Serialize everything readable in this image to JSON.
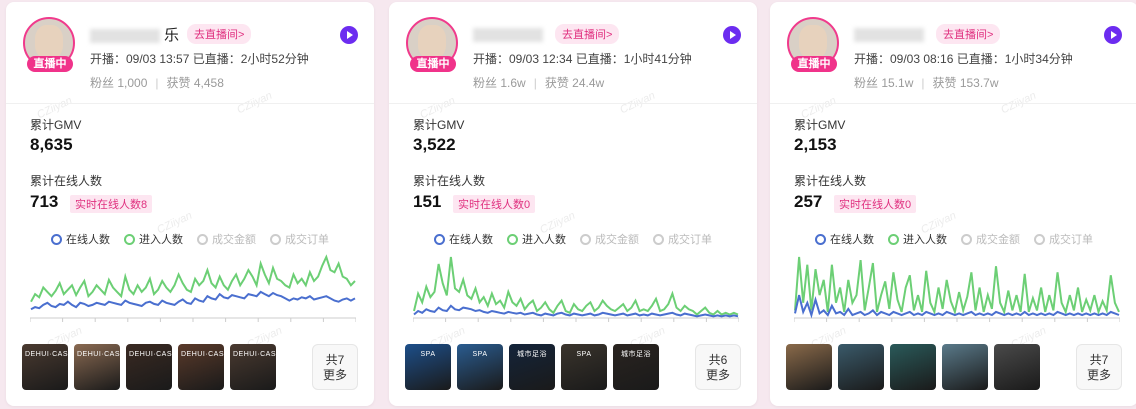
{
  "common": {
    "live_badge": "直播中",
    "goto_live": "去直播间>",
    "gmv_label": "累计GMV",
    "online_label": "累计在线人数",
    "watermark": "CZiiyan",
    "legend": [
      {
        "label": "在线人数",
        "color": "#4a6fcf",
        "active": true
      },
      {
        "label": "进入人数",
        "color": "#6ccf75",
        "active": true
      },
      {
        "label": "成交金额",
        "color": "#cccccc",
        "active": false
      },
      {
        "label": "成交订单",
        "color": "#cccccc",
        "active": false
      }
    ]
  },
  "cards": [
    {
      "name_suffix": "乐",
      "meta": "开播：09/03 13:57 已直播：2小时52分钟",
      "fans": "粉丝 1,000",
      "likes": "获赞 4,458",
      "gmv": "8,635",
      "online": "713",
      "realtime": "实时在线人数8",
      "more_count": "共7",
      "more_label": "更多",
      "thumb_colors": [
        "#4a3a30",
        "#8a6a52",
        "#3a2a22",
        "#5a3a2a",
        "#4a3a30"
      ],
      "thumb_texts": [
        "DEHUI·CASE",
        "DEHUI·CASE",
        "DEHUI·CASE",
        "DEHUI·CASE",
        "DEHUI·CASE"
      ],
      "chart_data": {
        "type": "line",
        "series": [
          {
            "name": "在线人数",
            "values": [
              8,
              10,
              9,
              12,
              14,
              11,
              10,
              13,
              12,
              15,
              12,
              10,
              14,
              13,
              11,
              12,
              14,
              13,
              12,
              15,
              14,
              13,
              12,
              16,
              14,
              13,
              12,
              11,
              14,
              15,
              13,
              12,
              16,
              14,
              13,
              12,
              15,
              17,
              14,
              13,
              18,
              16,
              15,
              20,
              18,
              17,
              22,
              19,
              18,
              21,
              20,
              19,
              18,
              22,
              21,
              20,
              24,
              22,
              20,
              23,
              21,
              20,
              18,
              16,
              18,
              17,
              19,
              18,
              20,
              17,
              18,
              19,
              20,
              18,
              16,
              15,
              17,
              18,
              16,
              18
            ]
          },
          {
            "name": "进入人数",
            "values": [
              15,
              22,
              19,
              28,
              24,
              20,
              25,
              32,
              22,
              26,
              30,
              21,
              28,
              34,
              20,
              24,
              30,
              26,
              22,
              35,
              28,
              24,
              20,
              38,
              26,
              22,
              30,
              24,
              28,
              36,
              22,
              26,
              34,
              28,
              24,
              30,
              40,
              32,
              26,
              24,
              36,
              30,
              34,
              44,
              32,
              28,
              38,
              30,
              26,
              34,
              40,
              30,
              36,
              44,
              38,
              30,
              50,
              40,
              32,
              46,
              36,
              34,
              30,
              28,
              40,
              32,
              36,
              30,
              42,
              34,
              38,
              48,
              56,
              44,
              42,
              50,
              38,
              36,
              30,
              34
            ]
          }
        ]
      }
    },
    {
      "name_suffix": "",
      "meta": "开播：09/03 12:34 已直播：1小时41分钟",
      "fans": "粉丝 1.6w",
      "likes": "获赞 24.4w",
      "gmv": "3,522",
      "online": "151",
      "realtime": "实时在线人数0",
      "more_count": "共6",
      "more_label": "更多",
      "thumb_colors": [
        "#1d4f8a",
        "#2a5c90",
        "#14243a",
        "#3a342c",
        "#2a2420"
      ],
      "thumb_texts": [
        "SPA",
        "SPA",
        "城市足浴",
        "SPA",
        "城市足浴"
      ],
      "chart_data": {
        "type": "line",
        "series": [
          {
            "name": "在线人数",
            "values": [
              4,
              8,
              6,
              10,
              8,
              7,
              12,
              9,
              8,
              14,
              10,
              9,
              12,
              11,
              10,
              8,
              9,
              7,
              6,
              8,
              7,
              6,
              5,
              7,
              6,
              5,
              6,
              4,
              5,
              6,
              4,
              3,
              5,
              4,
              3,
              5,
              6,
              4,
              3,
              5,
              4,
              3,
              4,
              5,
              3,
              4,
              6,
              5,
              4,
              3,
              4,
              5,
              3,
              4,
              5,
              3,
              4,
              3,
              5,
              4,
              3,
              4,
              5,
              6,
              4,
              3,
              5,
              4,
              3,
              2,
              3,
              4,
              3,
              2,
              3,
              2,
              3,
              2,
              3,
              2
            ]
          },
          {
            "name": "进入人数",
            "values": [
              8,
              28,
              18,
              36,
              24,
              30,
              62,
              40,
              26,
              70,
              34,
              30,
              44,
              26,
              22,
              34,
              18,
              24,
              14,
              28,
              16,
              20,
              12,
              30,
              18,
              14,
              22,
              10,
              16,
              20,
              8,
              12,
              18,
              10,
              6,
              14,
              20,
              8,
              6,
              16,
              10,
              8,
              14,
              18,
              8,
              12,
              20,
              14,
              10,
              8,
              12,
              16,
              8,
              12,
              20,
              8,
              10,
              8,
              14,
              22,
              8,
              10,
              16,
              28,
              12,
              8,
              14,
              10,
              8,
              4,
              8,
              12,
              6,
              4,
              8,
              4,
              6,
              4,
              6,
              4
            ]
          }
        ]
      }
    },
    {
      "name_suffix": "",
      "meta": "开播：09/03 08:16 已直播：1小时34分钟",
      "fans": "粉丝 15.1w",
      "likes": "获赞 153.7w",
      "gmv": "2,153",
      "online": "257",
      "realtime": "实时在线人数0",
      "more_count": "共7",
      "more_label": "更多",
      "thumb_colors": [
        "#8a6a4a",
        "#3a5a6a",
        "#2a5a5a",
        "#5a7a8a",
        "#4a4a4a"
      ],
      "thumb_texts": [
        "",
        "",
        "",
        "",
        ""
      ],
      "chart_data": {
        "type": "line",
        "series": [
          {
            "name": "在线人数",
            "values": [
              6,
              30,
              8,
              20,
              4,
              24,
              6,
              10,
              4,
              16,
              6,
              8,
              4,
              12,
              4,
              6,
              8,
              4,
              6,
              10,
              4,
              8,
              6,
              4,
              8,
              6,
              4,
              6,
              8,
              4,
              6,
              4,
              8,
              6,
              4,
              6,
              4,
              8,
              6,
              4,
              6,
              4,
              6,
              8,
              4,
              6,
              4,
              6,
              4,
              8,
              6,
              4,
              6,
              4,
              6,
              4,
              8,
              4,
              6,
              4,
              6,
              4,
              6,
              4,
              8,
              6,
              4,
              6,
              4,
              6,
              4,
              6,
              4,
              6,
              4,
              6,
              4,
              8,
              6,
              4
            ]
          },
          {
            "name": "进入人数",
            "values": [
              10,
              80,
              20,
              70,
              10,
              64,
              30,
              50,
              8,
              70,
              20,
              40,
              8,
              50,
              20,
              30,
              76,
              10,
              40,
              72,
              8,
              30,
              48,
              12,
              60,
              24,
              8,
              40,
              56,
              10,
              30,
              8,
              62,
              20,
              8,
              40,
              12,
              50,
              22,
              8,
              34,
              10,
              28,
              60,
              10,
              40,
              8,
              30,
              12,
              68,
              20,
              8,
              36,
              10,
              30,
              8,
              58,
              8,
              26,
              10,
              40,
              8,
              30,
              10,
              60,
              20,
              8,
              30,
              10,
              40,
              8,
              24,
              10,
              30,
              8,
              22,
              10,
              56,
              20,
              8
            ]
          }
        ]
      }
    }
  ]
}
